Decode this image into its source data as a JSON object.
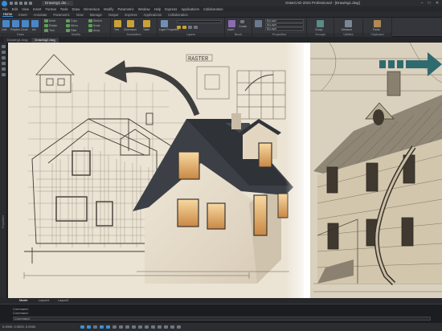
{
  "titlebar": {
    "tab": "Drawing1.dw…",
    "title": "GstarCAD 2024 Professional - [Drawing1.dwg]",
    "minimize": "–",
    "maximize": "□",
    "close": "✕"
  },
  "menu": [
    "File",
    "Edit",
    "View",
    "Insert",
    "Format",
    "Tools",
    "Draw",
    "Dimension",
    "Modify",
    "Parametric",
    "Window",
    "Help",
    "Express",
    "Applications",
    "Collaboration"
  ],
  "ribbon": {
    "tabs": [
      "Home",
      "Insert",
      "Annotate",
      "Parametric",
      "View",
      "Manage",
      "Output",
      "Express",
      "Applications",
      "Collaboration"
    ],
    "active_tab": "Home",
    "groups": [
      "Draw",
      "Modify",
      "Annotation",
      "Layers",
      "Block",
      "Properties",
      "Groups",
      "Utilities",
      "Clipboard"
    ],
    "draw_tools": [
      "Line",
      "Polyline",
      "Circle",
      "Arc"
    ],
    "modify_tools": [
      "Move",
      "Rotate",
      "Trim",
      "Copy",
      "Mirror",
      "Fillet",
      "Stretch",
      "Scale",
      "Array"
    ],
    "annotation_tools": [
      "Text",
      "Dimension",
      "Table"
    ],
    "layer_tools": [
      "Layer Properties"
    ],
    "block_tools": [
      "Insert",
      "Create"
    ],
    "properties_values": [
      "ByLayer",
      "ByLayer",
      "ByLayer"
    ],
    "groups_tools": [
      "Group"
    ],
    "utilities_tools": [
      "Measure"
    ],
    "clipboard_tools": [
      "Paste"
    ]
  },
  "file_tabs": [
    "Drawing1.dwg",
    "Drawing2.dwg"
  ],
  "sidebar_label": "Properties",
  "canvas": {
    "raster_label": "RASTER"
  },
  "layout_tabs": [
    "Model",
    "Layout1",
    "Layout2"
  ],
  "command": {
    "lines": [
      "Command:",
      "Command:"
    ],
    "input_label": "Command:"
  },
  "status": {
    "coords": "0.0000, 0.0000, 0.0000"
  },
  "colors": {
    "accent": "#3c8fd9",
    "arrow": "#2f6a6e",
    "paper": "#e9e0d0"
  }
}
